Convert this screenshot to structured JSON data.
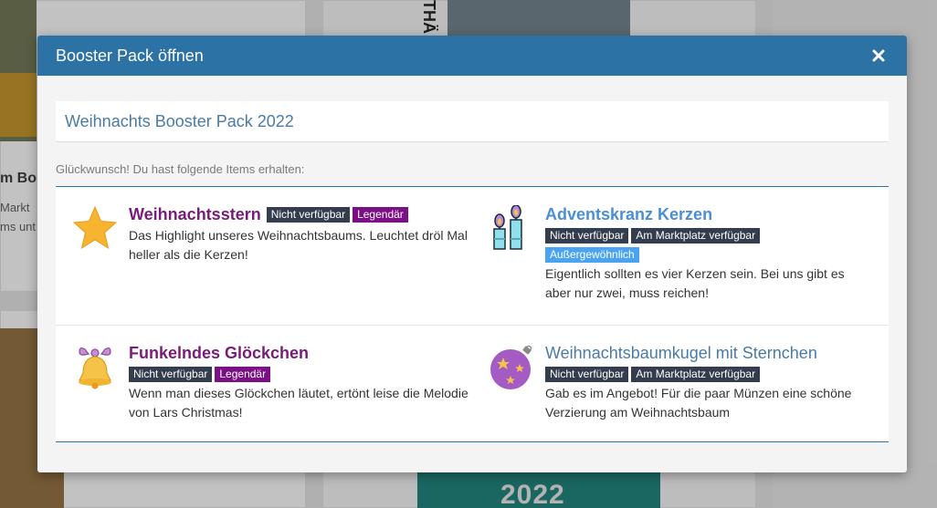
{
  "background": {
    "partial_title": "m Bo",
    "partial_line1": "Markt",
    "partial_line2": "ms unt",
    "vertical_text": "THÄ",
    "year_text": "2022"
  },
  "modal": {
    "title": "Booster Pack öffnen",
    "close_icon": "close-icon",
    "pack_title": "Weihnachts Booster Pack 2022",
    "congrats": "Glückwunsch! Du hast folgende Items erhalten:",
    "items": [
      {
        "name": "Weihnachtsstern",
        "name_color": "#7a1b7a",
        "icon": "star-icon",
        "badges": [
          "Nicht verfügbar",
          "Legendär"
        ],
        "description": "Das Highlight unseres Weihnachtsbaums. Leuchtet dröl Mal heller als die Kerzen!"
      },
      {
        "name": "Adventskranz Kerzen",
        "name_color": "#4a8fd6",
        "icon": "candles-icon",
        "badges": [
          "Nicht verfügbar",
          "Am Marktplatz verfügbar",
          "Außergewöhnlich"
        ],
        "description": "Eigentlich sollten es vier Kerzen sein. Bei uns gibt es aber nur zwei, muss reichen!"
      },
      {
        "name": "Funkelndes Glöckchen",
        "name_color": "#7a1b7a",
        "icon": "bell-icon",
        "badges": [
          "Nicht verfügbar",
          "Legendär"
        ],
        "description": "Wenn man dieses Glöckchen läutet, ertönt leise die Melodie von Lars Christmas!"
      },
      {
        "name": "Weihnachtsbaumkugel mit Sternchen",
        "name_color": "#4a7ba6",
        "icon": "ornament-icon",
        "badges": [
          "Nicht verfügbar",
          "Am Marktplatz verfügbar"
        ],
        "description": "Gab es im Angebot! Für die paar Münzen eine schöne Verzierung am Weihnachtsbaum"
      }
    ]
  },
  "colors": {
    "header": "#2c72a5",
    "legendary": "#7b0f86",
    "dark_badge": "#333d4d",
    "extraordinary": "#4aa3f0"
  }
}
